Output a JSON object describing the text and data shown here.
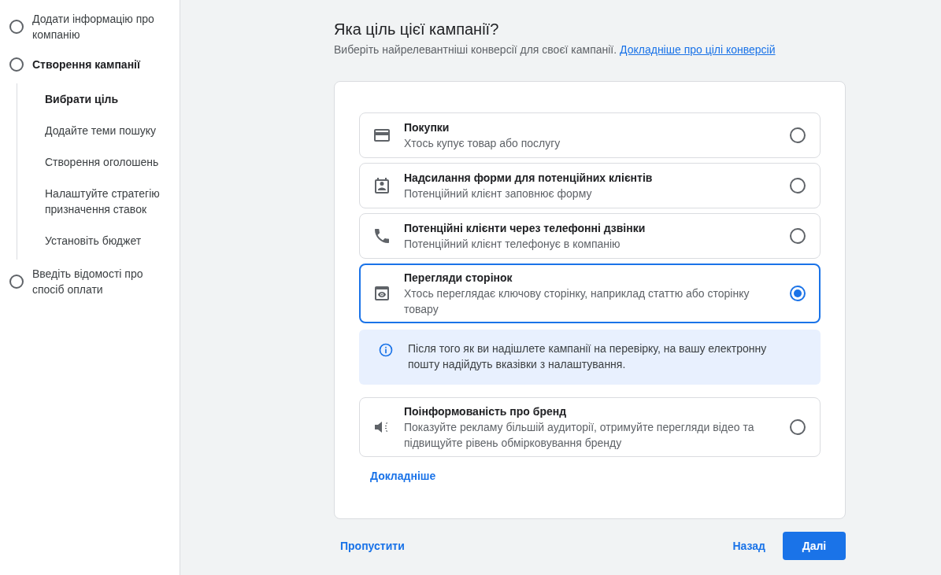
{
  "sidebar": {
    "steps": [
      {
        "label": "Додати інформацію про компанію",
        "selected": false
      },
      {
        "label": "Створення кампанії",
        "selected": true,
        "children": [
          {
            "label": "Вибрати ціль",
            "selected": true
          },
          {
            "label": "Додайте теми пошуку",
            "selected": false
          },
          {
            "label": "Створення оголошень",
            "selected": false
          },
          {
            "label": "Налаштуйте стратегію призначення ставок",
            "selected": false
          },
          {
            "label": "Установіть бюджет",
            "selected": false
          }
        ]
      },
      {
        "label": "Введіть відомості про спосіб оплати",
        "selected": false
      }
    ]
  },
  "heading": "Яка ціль цієї кампанії?",
  "subtitle": "Виберіть найрелевантніші конверсії для своєї кампанії.",
  "subtitle_link": "Докладніше про цілі конверсій",
  "goals": [
    {
      "title": "Покупки",
      "description": "Хтось купує товар або послугу",
      "selected": false
    },
    {
      "title": "Надсилання форми для потенційних клієнтів",
      "description": "Потенційний клієнт заповнює форму",
      "selected": false
    },
    {
      "title": "Потенційні клієнти через телефонні дзвінки",
      "description": "Потенційний клієнт телефонує в компанію",
      "selected": false
    },
    {
      "title": "Перегляди сторінок",
      "description": "Хтось переглядає ключову сторінку, наприклад статтю або сторінку товару",
      "selected": true,
      "note": "Після того як ви надішлете кампанії на перевірку, на вашу електронну пошту надійдуть вказівки з налаштування."
    },
    {
      "title": "Поінформованість про бренд",
      "description": "Показуйте рекламу більшій аудиторії, отримуйте перегляди відео та підвищуйте рівень обмірковування бренду",
      "selected": false
    }
  ],
  "more_link": "Докладніше",
  "footer": {
    "skip": "Пропустити",
    "back": "Назад",
    "next": "Далі"
  }
}
